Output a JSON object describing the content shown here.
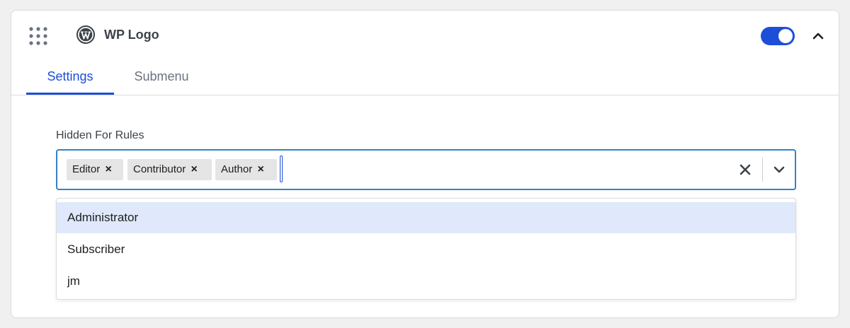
{
  "widget": {
    "title": "WP Logo",
    "enabled": true,
    "icons": {
      "drag": "drag-dots-icon",
      "logo": "wordpress-logo-icon",
      "collapse": "chevron-up-icon"
    },
    "colors": {
      "accent": "#1d4ed8",
      "focus_border": "#3582c4",
      "active_option": "#dfe9fb"
    }
  },
  "tabs": [
    {
      "label": "Settings",
      "active": true
    },
    {
      "label": "Submenu",
      "active": false
    }
  ],
  "field": {
    "label": "Hidden For Rules",
    "selected": [
      "Editor",
      "Contributor",
      "Author"
    ],
    "chip_remove_glyph": "×",
    "icons": {
      "clear": "clear-x-icon",
      "dropdown": "chevron-down-icon"
    }
  },
  "menu": {
    "options": [
      "Administrator",
      "Subscriber",
      "jm"
    ],
    "highlighted": "Administrator"
  }
}
